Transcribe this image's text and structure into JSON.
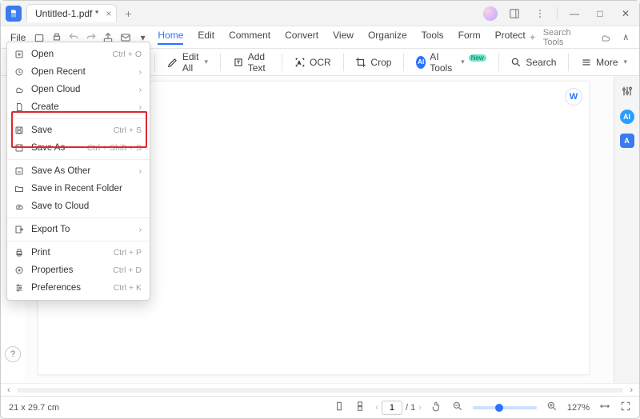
{
  "titlebar": {
    "tab_title": "Untitled-1.pdf *",
    "new_tab": "+"
  },
  "window_controls": {
    "min": "—",
    "max": "□",
    "close": "✕"
  },
  "menubar": {
    "file": "File",
    "tabs": [
      "Home",
      "Edit",
      "Comment",
      "Convert",
      "View",
      "Organize",
      "Tools",
      "Form",
      "Protect"
    ],
    "active_tab": "Home",
    "search_placeholder": "Search Tools"
  },
  "toolbar": {
    "edit_all": "Edit All",
    "add_text": "Add Text",
    "ocr": "OCR",
    "crop": "Crop",
    "ai_tools": "AI Tools",
    "ai_tools_badge": "New",
    "search": "Search",
    "more": "More"
  },
  "dropdown": {
    "items": [
      {
        "icon": "plus",
        "label": "Open",
        "shortcut": "Ctrl + O"
      },
      {
        "icon": "clock",
        "label": "Open Recent",
        "submenu": true
      },
      {
        "icon": "cloud",
        "label": "Open Cloud",
        "submenu": true
      },
      {
        "icon": "doc",
        "label": "Create",
        "submenu": true
      }
    ],
    "save_items": [
      {
        "icon": "save",
        "label": "Save",
        "shortcut": "Ctrl + S"
      },
      {
        "icon": "saveas",
        "label": "Save As",
        "shortcut": "Ctrl + Shift + S"
      }
    ],
    "items2": [
      {
        "icon": "saveother",
        "label": "Save As Other",
        "submenu": true
      },
      {
        "icon": "folder",
        "label": "Save in Recent Folder"
      },
      {
        "icon": "cloudup",
        "label": "Save to Cloud"
      }
    ],
    "items3": [
      {
        "icon": "export",
        "label": "Export To",
        "submenu": true
      }
    ],
    "items4": [
      {
        "icon": "print",
        "label": "Print",
        "shortcut": "Ctrl + P"
      },
      {
        "icon": "props",
        "label": "Properties",
        "shortcut": "Ctrl + D"
      },
      {
        "icon": "prefs",
        "label": "Preferences",
        "shortcut": "Ctrl + K"
      }
    ]
  },
  "status": {
    "dimensions": "21 x 29.7 cm",
    "page_current": "1",
    "page_total": "/ 1",
    "zoom": "127%"
  },
  "rail": {
    "ai1": "AI",
    "ai2": "A"
  },
  "float_w": "W"
}
